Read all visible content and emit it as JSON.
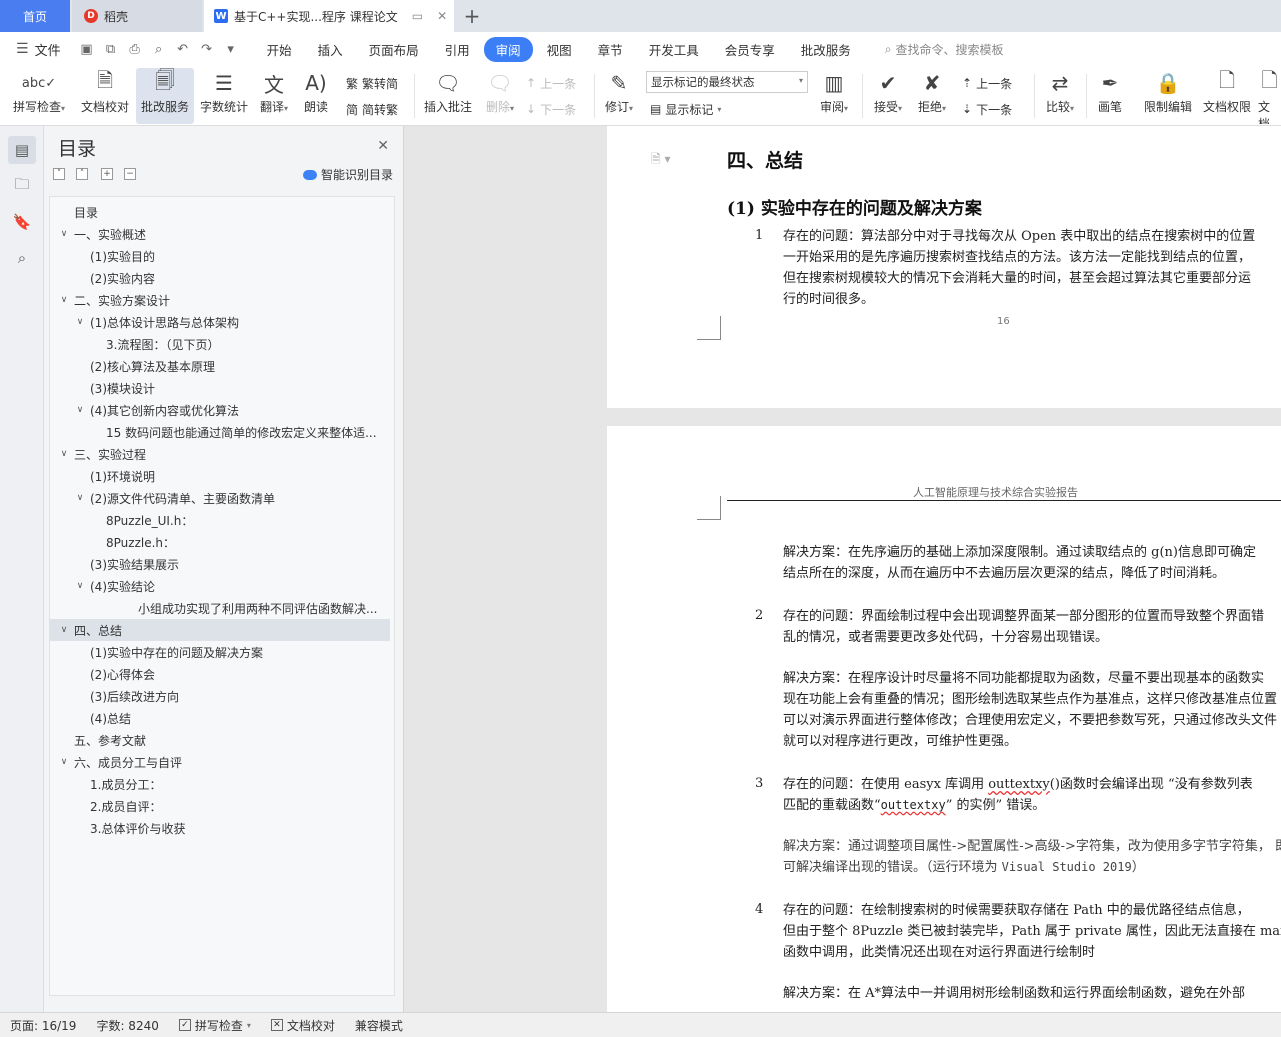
{
  "tabs": {
    "home": "首页",
    "docer": "稻壳",
    "doc": "基于C++实现...程序 课程论文",
    "add": "+"
  },
  "menu": {
    "file": "文件",
    "items": [
      "开始",
      "插入",
      "页面布局",
      "引用",
      "审阅",
      "视图",
      "章节",
      "开发工具",
      "会员专享",
      "批改服务"
    ],
    "active": "审阅",
    "search": "查找命令、搜索模板"
  },
  "ribbon": {
    "spell": "拼写检查",
    "proof": "文档校对",
    "correct": "批改服务",
    "wordcount": "字数统计",
    "translate": "翻译",
    "read": "朗读",
    "trad": "繁转简",
    "simp": "简转繁",
    "insert_comment": "插入批注",
    "delete": "删除",
    "prev": "上一条",
    "next": "下一条",
    "revise": "修订",
    "markup_state": "显示标记的最终状态",
    "show_markup": "显示标记",
    "review": "审阅",
    "accept": "接受",
    "reject": "拒绝",
    "prev2": "上一条",
    "next2": "下一条",
    "compare": "比较",
    "pen": "画笔",
    "restrict": "限制编辑",
    "doc_perm": "文档权限",
    "doc_more": "文档"
  },
  "nav": {
    "title": "目录",
    "smart": "智能识别目录",
    "toc": [
      {
        "text": "目录",
        "level": 0,
        "arrow": ""
      },
      {
        "text": "一、实验概述",
        "level": 0,
        "arrow": "v"
      },
      {
        "text": "(1)实验目的",
        "level": 1,
        "arrow": ""
      },
      {
        "text": "(2)实验内容",
        "level": 1,
        "arrow": ""
      },
      {
        "text": "二、实验方案设计",
        "level": 0,
        "arrow": "v"
      },
      {
        "text": "(1)总体设计思路与总体架构",
        "level": 1,
        "arrow": "v"
      },
      {
        "text": "3.流程图：（见下页）",
        "level": 2,
        "arrow": ""
      },
      {
        "text": "(2)核心算法及基本原理",
        "level": 1,
        "arrow": ""
      },
      {
        "text": "(3)模块设计",
        "level": 1,
        "arrow": ""
      },
      {
        "text": "(4)其它创新内容或优化算法",
        "level": 1,
        "arrow": "v"
      },
      {
        "text": "15 数码问题也能通过简单的修改宏定义来整体适...",
        "level": 2,
        "arrow": ""
      },
      {
        "text": "三、实验过程",
        "level": 0,
        "arrow": "v"
      },
      {
        "text": "(1)环境说明",
        "level": 1,
        "arrow": ""
      },
      {
        "text": "(2)源文件代码清单、主要函数清单",
        "level": 1,
        "arrow": "v"
      },
      {
        "text": "8Puzzle_UI.h：",
        "level": 2,
        "arrow": ""
      },
      {
        "text": "8Puzzle.h：",
        "level": 2,
        "arrow": ""
      },
      {
        "text": "(3)实验结果展示",
        "level": 1,
        "arrow": ""
      },
      {
        "text": "(4)实验结论",
        "level": 1,
        "arrow": "v"
      },
      {
        "text": "小组成功实现了利用两种不同评估函数解决...",
        "level": 3,
        "arrow": ""
      },
      {
        "text": "四、总结",
        "level": 0,
        "arrow": "v",
        "selected": true
      },
      {
        "text": "(1)实验中存在的问题及解决方案",
        "level": 1,
        "arrow": ""
      },
      {
        "text": "(2)心得体会",
        "level": 1,
        "arrow": ""
      },
      {
        "text": "(3)后续改进方向",
        "level": 1,
        "arrow": ""
      },
      {
        "text": "(4)总结",
        "level": 1,
        "arrow": ""
      },
      {
        "text": "五、参考文献",
        "level": 0,
        "arrow": ""
      },
      {
        "text": "六、成员分工与自评",
        "level": 0,
        "arrow": "v"
      },
      {
        "text": "1.成员分工：",
        "level": 1,
        "arrow": ""
      },
      {
        "text": "2.成员自评：",
        "level": 1,
        "arrow": ""
      },
      {
        "text": "3.总体评价与收获",
        "level": 1,
        "arrow": ""
      }
    ]
  },
  "doc": {
    "h1": "四、总结",
    "h2": "(1)  实验中存在的问题及解决方案",
    "item1_num": "1",
    "item1_lines": [
      "存在的问题：算法部分中对于寻找每次从 Open 表中取出的结点在搜索树中的位置",
      "一开始采用的是先序遍历搜索树查找结点的方法。该方法一定能找到结点的位置，",
      "但在搜索树规模较大的情况下会消耗大量的时间，甚至会超过算法其它重要部分运",
      "行的时间很多。"
    ],
    "page_number": "16",
    "running_header": "人工智能原理与技术综合实验报告",
    "sol1_lines": [
      "解决方案：在先序遍历的基础上添加深度限制。通过读取结点的 g(n)信息即可确定",
      "结点所在的深度，从而在遍历中不去遍历层次更深的结点，降低了时间消耗。"
    ],
    "item2_num": "2",
    "item2_lines": [
      "存在的问题：界面绘制过程中会出现调整界面某一部分图形的位置而导致整个界面错",
      "乱的情况，或者需要更改多处代码，十分容易出现错误。"
    ],
    "sol2_lines": [
      "解决方案：在程序设计时尽量将不同功能都提取为函数，尽量不要出现基本的函数实",
      "现在功能上会有重叠的情况；图形绘制选取某些点作为基准点，这样只修改基准点位置",
      "可以对演示界面进行整体修改；合理使用宏定义，不要把参数写死，只通过修改头文件",
      "就可以对程序进行更改，可维护性更强。"
    ],
    "item3_num": "3",
    "item3_line1_a": "存在的问题：在使用 ",
    "item3_line1_b": "easyx",
    "item3_line1_c": " 库调用 ",
    "item3_line1_d": "outtextxy",
    "item3_line1_e": "()函数时会编译出现 “没有参数列表",
    "item3_line2_a": "匹配的重载函数“",
    "item3_line2_b": "outtextxy",
    "item3_line2_c": "” 的实例” 错误。",
    "sol3_line1": "解决方案：通过调整项目属性->配置属性->高级->字符集，改为使用多字节字符集， 即",
    "sol3_line2_a": "可解决编译出现的错误。（运行环境为 ",
    "sol3_line2_b": "Visual Studio 2019",
    "sol3_line2_c": "）",
    "item4_num": "4",
    "item4_lines": [
      "存在的问题：在绘制搜索树的时候需要获取存储在 Path 中的最优路径结点信息，",
      "但由于整个 8Puzzle 类已被封装完毕，Path 属于 private 属性，因此无法直接在 main",
      "函数中调用，此类情况还出现在对运行界面进行绘制时"
    ],
    "sol4_line": "解决方案：在 A*算法中一并调用树形绘制函数和运行界面绘制函数，避免在外部"
  },
  "status": {
    "page": "页面: 16/19",
    "words": "字数: 8240",
    "spell": "拼写检查",
    "proof": "文档校对",
    "compat": "兼容模式"
  }
}
